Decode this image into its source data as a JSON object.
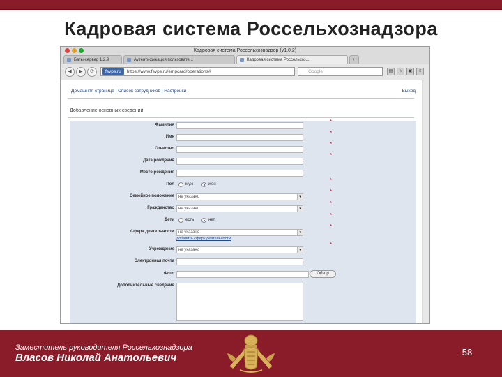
{
  "slide": {
    "title": "Кадровая система Россельхознадзора",
    "footer_role": "Заместитель руководителя Россельхознадзора",
    "footer_name": "Власов Николай Анатольевич",
    "page_number": "58",
    "colors": {
      "brand": "#8a1c2a",
      "gold": "#d8b15a"
    }
  },
  "browser": {
    "window_title": "Кадровая система Россельхознадзор (v1.0.2)",
    "tabs": [
      {
        "label": "Багы-сервер 1.2.9",
        "active": false
      },
      {
        "label": "Аутентификация пользовате...",
        "active": false
      },
      {
        "label": "Кадровая система Россельхоз...",
        "active": true
      }
    ],
    "address": {
      "site_badge": "fsvps.ru",
      "url": "https://www.fsvps.ru/empcard/operations#"
    },
    "search_placeholder": "Google"
  },
  "page": {
    "menu": {
      "home": "Домашняя страница",
      "separator": "|",
      "staff": "Список сотрудников",
      "settings": "Настройки"
    },
    "logout": "Выход",
    "section_title": "Добавление основных сведений",
    "form": {
      "surname": "Фамилия",
      "name": "Имя",
      "patronymic": "Отчество",
      "birth_date": "Дата рождения",
      "birth_place": "Место рождения",
      "gender": {
        "label": "Пол",
        "options": [
          "муж",
          "жен"
        ],
        "selected": "жен"
      },
      "marital": {
        "label": "Семейное положение",
        "value": "не указано"
      },
      "citizenship": {
        "label": "Гражданство",
        "value": "не указано"
      },
      "children": {
        "label": "Дети",
        "options": [
          "есть",
          "нет"
        ],
        "selected": "нет"
      },
      "activity": {
        "label": "Сфера деятельности",
        "value": "не указано",
        "add_link": "добавить сферу деятельности"
      },
      "institution": {
        "label": "Учреждение",
        "value": "не указано"
      },
      "email": "Электронная почта",
      "photo": {
        "label": "Фото",
        "button": "Обзор"
      },
      "additional": "Дополнительные сведения",
      "required_mark": "*"
    }
  }
}
